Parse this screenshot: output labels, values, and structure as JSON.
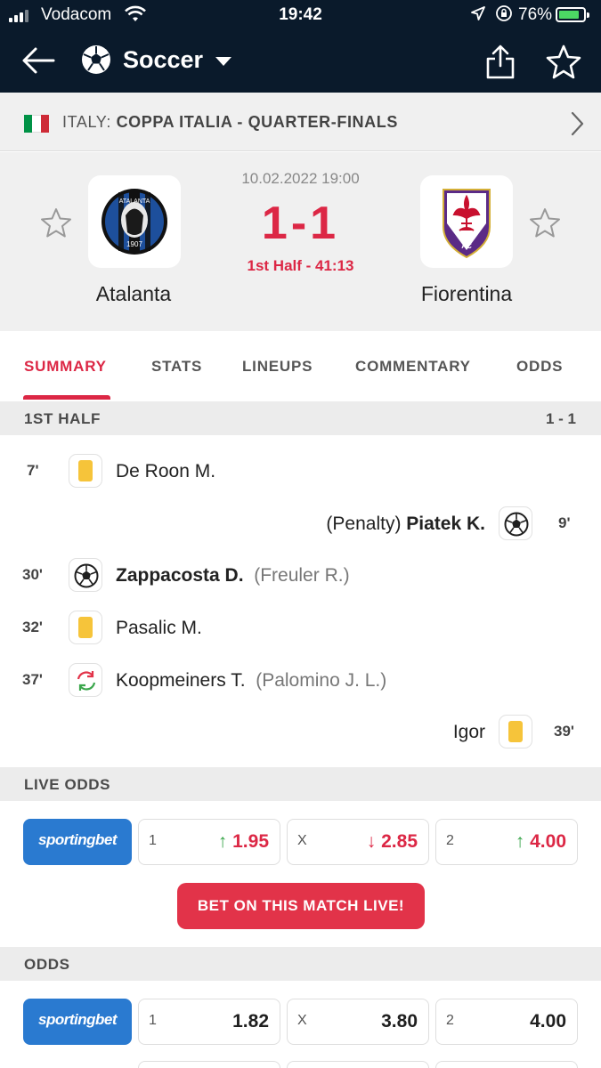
{
  "status_bar": {
    "carrier": "Vodacom",
    "time": "19:42",
    "battery": "76%"
  },
  "nav": {
    "title": "Soccer"
  },
  "competition": {
    "country": "ITALY:",
    "name": "COPPA ITALIA - QUARTER-FINALS",
    "flag_colors": [
      "#009246",
      "#ffffff",
      "#ce2b37"
    ]
  },
  "match": {
    "date": "10.02.2022 19:00",
    "score": "1-1",
    "status": "1st Half - 41:13",
    "home": {
      "name": "Atalanta"
    },
    "away": {
      "name": "Fiorentina"
    }
  },
  "tabs": [
    "SUMMARY",
    "STATS",
    "LINEUPS",
    "COMMENTARY",
    "ODDS"
  ],
  "first_half": {
    "label": "1ST HALF",
    "score": "1 - 1"
  },
  "events": [
    {
      "minute": "7'",
      "player": "De Roon M.",
      "icon": "yellow-card-icon"
    },
    {
      "minute": "9'",
      "prefix": "(Penalty)",
      "player": "Piatek K.",
      "icon": "ball-icon"
    },
    {
      "minute": "30'",
      "player": "Zappacosta D.",
      "assist": "(Freuler R.)",
      "icon": "ball-icon"
    },
    {
      "minute": "32'",
      "player": "Pasalic M.",
      "icon": "yellow-card-icon"
    },
    {
      "minute": "37'",
      "player": "Koopmeiners T.",
      "assist": "(Palomino J. L.)",
      "icon": "substitution-icon"
    },
    {
      "minute": "39'",
      "player": "Igor",
      "icon": "yellow-card-icon"
    }
  ],
  "live_odds": {
    "label": "LIVE ODDS",
    "bookmaker": "sportingbet",
    "odds": [
      {
        "key": "1",
        "arrow": "↑",
        "value": "1.95"
      },
      {
        "key": "X",
        "arrow": "↓",
        "value": "2.85"
      },
      {
        "key": "2",
        "arrow": "↑",
        "value": "4.00"
      }
    ],
    "button": "BET ON THIS MATCH LIVE!"
  },
  "pre_odds": {
    "label": "ODDS",
    "bookmaker": "sportingbet",
    "odds": [
      {
        "key": "1",
        "value": "1.82"
      },
      {
        "key": "X",
        "value": "3.80"
      },
      {
        "key": "2",
        "value": "4.00"
      }
    ]
  },
  "colors": {
    "accent": "#dc2745",
    "header": "#0a1a2b",
    "yellow_card": "#f6c43a",
    "bookmaker": "#2a7ad0"
  }
}
